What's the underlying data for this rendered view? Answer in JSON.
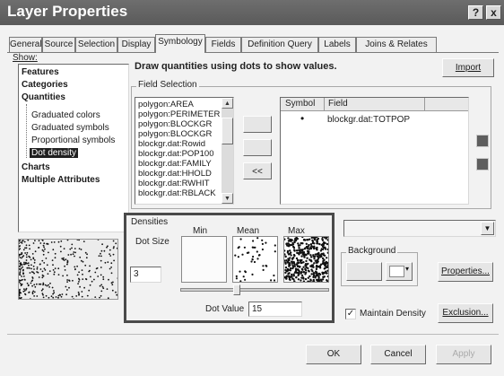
{
  "window": {
    "title": "Layer Properties",
    "help_label": "?",
    "close_label": "x"
  },
  "tabs": [
    {
      "label": "General"
    },
    {
      "label": "Source"
    },
    {
      "label": "Selection"
    },
    {
      "label": "Display"
    },
    {
      "label": "Symbology",
      "active": true
    },
    {
      "label": "Fields"
    },
    {
      "label": "Definition Query"
    },
    {
      "label": "Labels"
    },
    {
      "label": "Joins & Relates"
    }
  ],
  "show": {
    "label": "Show:",
    "items": [
      {
        "label": "Features",
        "bold": true
      },
      {
        "label": "Categories",
        "bold": true
      },
      {
        "label": "Quantities",
        "bold": true
      },
      {
        "label": "Graduated colors"
      },
      {
        "label": "Graduated symbols"
      },
      {
        "label": "Proportional symbols"
      },
      {
        "label": "Dot density",
        "selected": true
      },
      {
        "label": "Charts",
        "bold": true
      },
      {
        "label": "Multiple Attributes",
        "bold": true
      }
    ]
  },
  "heading": "Draw quantities using dots to show values.",
  "import_label": "Import",
  "field_selection": {
    "label": "Field Selection",
    "fields": [
      "polygon:AREA",
      "polygon:PERIMETER",
      "polygon:BLOCKGR",
      "polygon:BLOCKGR",
      "blockgr.dat:Rowid",
      "blockgr.dat:POP100",
      "blockgr.dat:FAMILY",
      "blockgr.dat:HHOLD",
      "blockgr.dat:RWHIT",
      "blockgr.dat:RBLACK"
    ],
    "move_all_back_label": "<<",
    "symbol_header": "Symbol",
    "field_header": "Field",
    "selected_symbol": "•",
    "selected_field": "blockgr.dat:TOTPOP"
  },
  "densities": {
    "label": "Densities",
    "dot_size_label": "Dot Size",
    "dot_size_value": "3",
    "min_label": "Min",
    "mean_label": "Mean",
    "max_label": "Max",
    "dot_value_label": "Dot Value",
    "dot_value": "15",
    "slider_level": 0.38
  },
  "background": {
    "label": "Background",
    "properties_label": "Properties...",
    "maintain_density_label": "Maintain Density",
    "maintain_density_checked": true,
    "exclusion_label": "Exclusion..."
  },
  "footer": {
    "ok_label": "OK",
    "cancel_label": "Cancel",
    "apply_label": "Apply"
  }
}
